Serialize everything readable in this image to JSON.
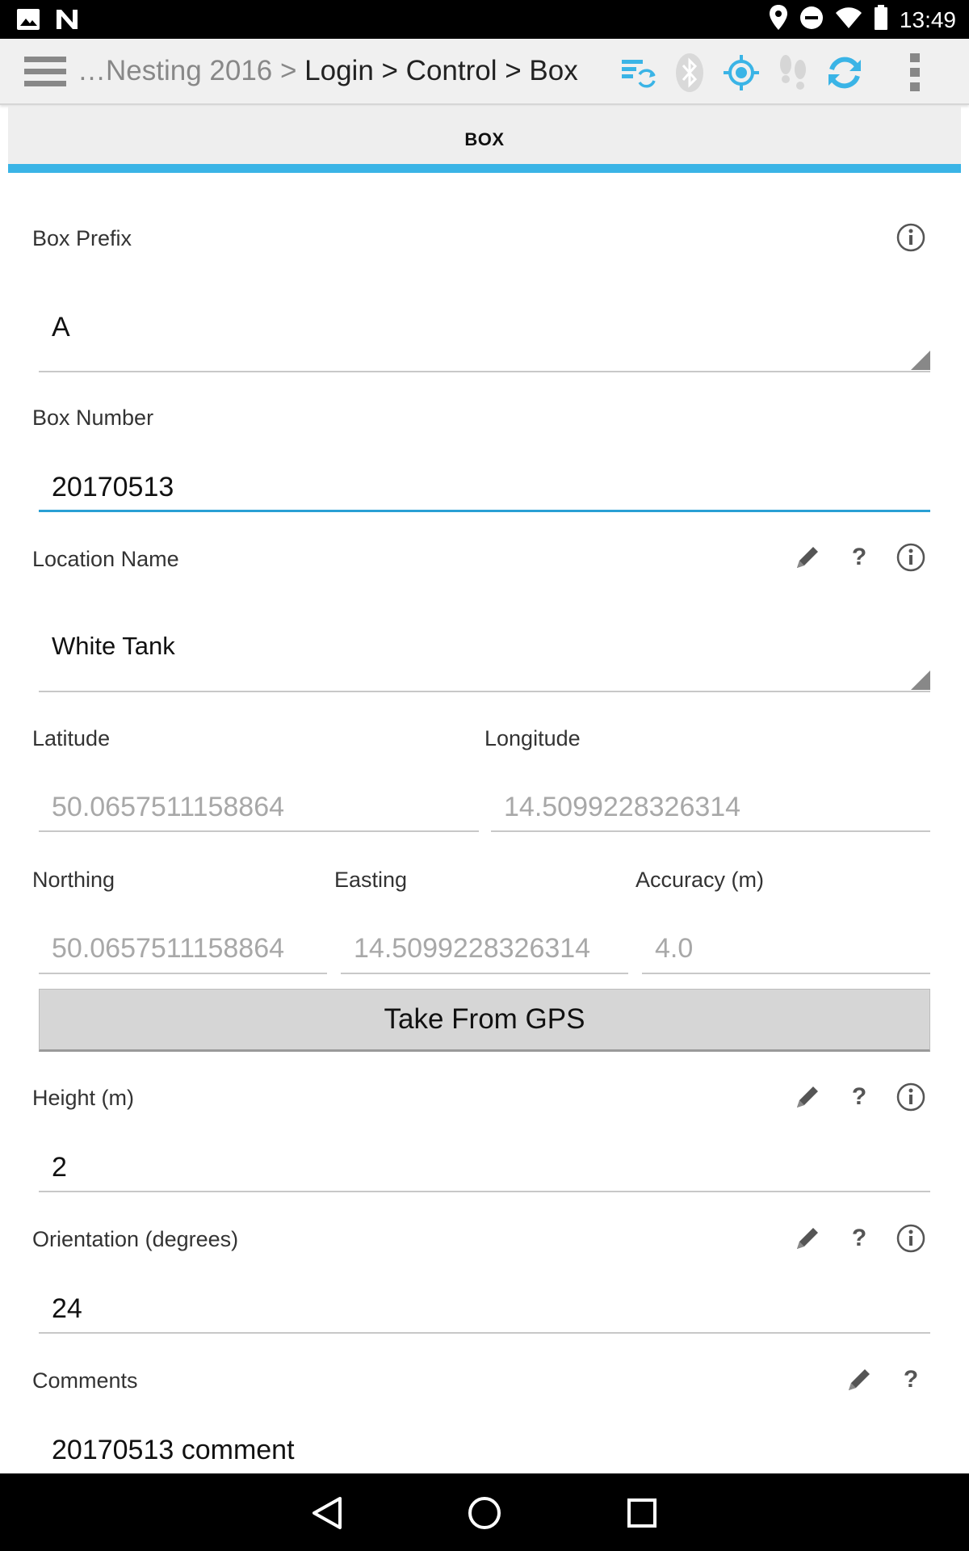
{
  "status_bar": {
    "time": "13:49",
    "left_icons": [
      "image-icon",
      "n-logo-icon"
    ],
    "right_icons": [
      "location-pin-icon",
      "do-not-disturb-icon",
      "wifi-icon",
      "battery-icon"
    ]
  },
  "action_bar": {
    "breadcrumb_dim": "…Nesting 2016 >",
    "breadcrumb_path": " Login > Control > Box",
    "icons": [
      "sync-list-icon",
      "bluetooth-icon",
      "gps-target-icon",
      "footsteps-icon",
      "refresh-icon",
      "overflow-menu-icon"
    ],
    "accent_color": "#3ab4e6"
  },
  "tab": {
    "label": "BOX"
  },
  "form": {
    "box_prefix": {
      "label": "Box Prefix",
      "value": "A"
    },
    "box_number": {
      "label": "Box Number",
      "value": "20170513"
    },
    "location_name": {
      "label": "Location Name",
      "value": "White Tank"
    },
    "latitude": {
      "label": "Latitude",
      "value": "50.0657511158864"
    },
    "longitude": {
      "label": "Longitude",
      "value": "14.5099228326314"
    },
    "northing": {
      "label": "Northing",
      "value": "50.0657511158864"
    },
    "easting": {
      "label": "Easting",
      "value": "14.5099228326314"
    },
    "accuracy": {
      "label": "Accuracy (m)",
      "value": "4.0"
    },
    "gps_button": "Take From GPS",
    "height": {
      "label": "Height (m)",
      "value": "2"
    },
    "orientation": {
      "label": "Orientation (degrees)",
      "value": "24"
    },
    "comments": {
      "label": "Comments",
      "value": "20170513 comment"
    },
    "help_mark": "?"
  },
  "nav_bar": {
    "buttons": [
      "back-icon",
      "home-icon",
      "recents-icon"
    ]
  }
}
